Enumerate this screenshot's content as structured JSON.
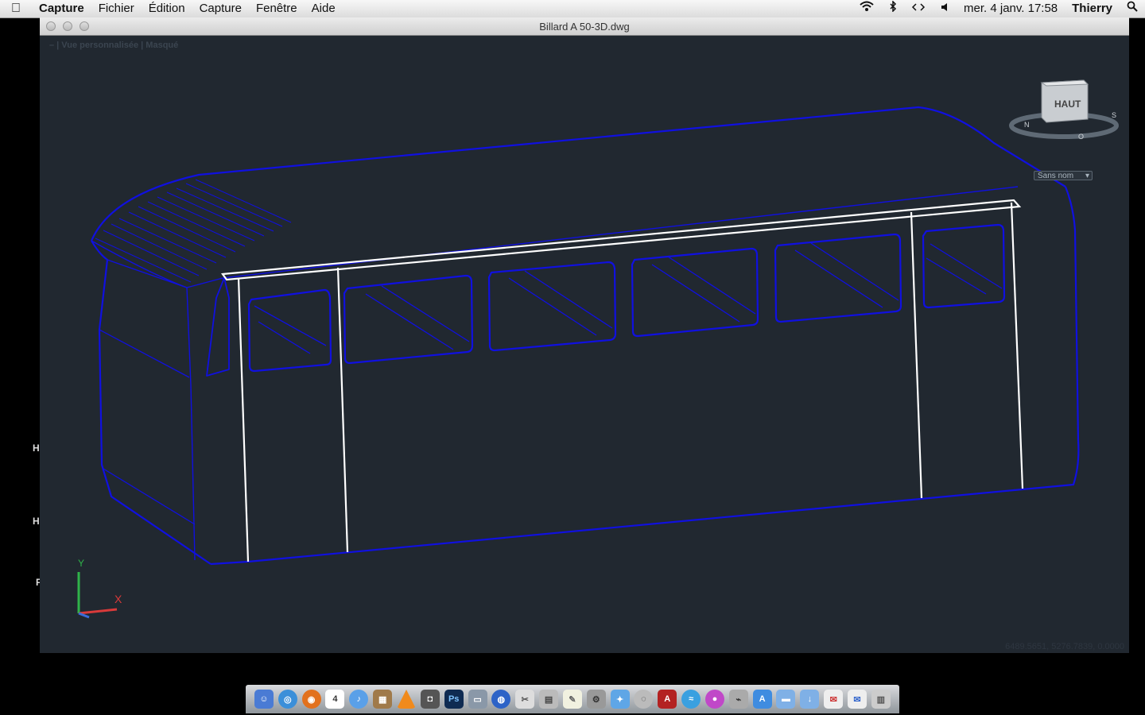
{
  "menubar": {
    "apple_icon": "apple-icon",
    "app_name": "Capture",
    "items": [
      "Fichier",
      "Édition",
      "Capture",
      "Fenêtre",
      "Aide"
    ],
    "status": {
      "icons": [
        "wifi-icon",
        "bluetooth-icon",
        "sync-icon",
        "volume-icon"
      ],
      "datetime": "mer. 4 janv.  17:58",
      "user": "Thierry"
    }
  },
  "window": {
    "title": "Billard A 50-3D.dwg",
    "viewport_label": "–  |  Vue personnalisée  |  Masqué",
    "viewcube": {
      "face": "HAUT",
      "menu": "Sans nom",
      "compass": [
        "N",
        "O",
        "S"
      ]
    },
    "ucs": {
      "x_label": "X",
      "y_label": "Y"
    },
    "coordinates": "6489.5651, 5276.7839, 0.0000",
    "left_edge_letters": [
      "H",
      "H",
      "F"
    ]
  },
  "colors": {
    "model_blue": "#1010e0",
    "model_white": "#ffffff",
    "canvas_bg": "#212830"
  },
  "dock": {
    "items": [
      "finder-icon",
      "safari-icon",
      "firefox-icon",
      "calendar-icon",
      "itunes-icon",
      "photo-icon",
      "vlc-icon",
      "camera-icon",
      "photoshop-icon",
      "scanner-icon",
      "globe-icon",
      "preview-icon",
      "calculator-icon",
      "notes-icon",
      "settings-icon",
      "utility-icon",
      "browser-icon",
      "autocad-icon",
      "airdrop-icon",
      "bluetooth-app-icon",
      "wireless-icon",
      "app-store-icon",
      "folder-icon",
      "downloads-icon",
      "mail-icon",
      "mail2-icon",
      "trash-icon"
    ],
    "calendar_day": "4",
    "ps_label": "Ps"
  }
}
